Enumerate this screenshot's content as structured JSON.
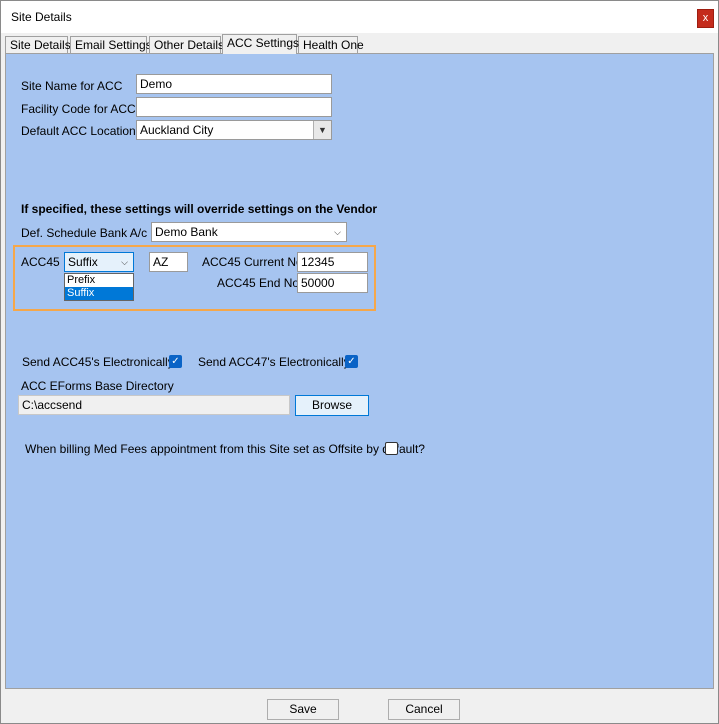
{
  "window": {
    "title": "Site Details",
    "close_label": "x"
  },
  "tabs": [
    {
      "label": "Site Details",
      "active": false
    },
    {
      "label": "Email Settings",
      "active": false
    },
    {
      "label": "Other Details",
      "active": false
    },
    {
      "label": "ACC Settings",
      "active": true
    },
    {
      "label": "Health One",
      "active": false
    }
  ],
  "form": {
    "site_name_label": "Site Name for ACC",
    "site_name_value": "Demo",
    "facility_code_label": "Facility Code for ACC",
    "facility_code_value": "",
    "default_location_label": "Default ACC Location",
    "default_location_value": "Auckland City",
    "override_note": "If specified, these settings will override settings on the Vendor",
    "schedule_bank_label": "Def. Schedule Bank A/c",
    "schedule_bank_value": "Demo Bank",
    "acc45_label": "ACC45",
    "acc45_mode_value": "Suffix",
    "acc45_mode_options": [
      "Prefix",
      "Suffix"
    ],
    "acc45_affix_value": "AZ",
    "acc45_current_label": "ACC45 Current No",
    "acc45_current_value": "12345",
    "acc45_end_label": "ACC45 End No",
    "acc45_end_value": "50000",
    "send_acc45_label": "Send ACC45's Electronically?",
    "send_acc45_checked": true,
    "send_acc47_label": "Send ACC47's Electronically?",
    "send_acc47_checked": true,
    "eforms_dir_label": "ACC EForms Base Directory",
    "eforms_dir_value": "C:\\accsend",
    "browse_label": "Browse",
    "offsite_label": "When billing Med Fees appointment from this Site set as Offsite by default?",
    "offsite_checked": false
  },
  "footer": {
    "save_label": "Save",
    "cancel_label": "Cancel"
  },
  "colors": {
    "panel_bg": "#a6c4f0",
    "highlight_border": "#f5a74a",
    "selection": "#0078d7",
    "checkbox": "#0a63c6"
  }
}
